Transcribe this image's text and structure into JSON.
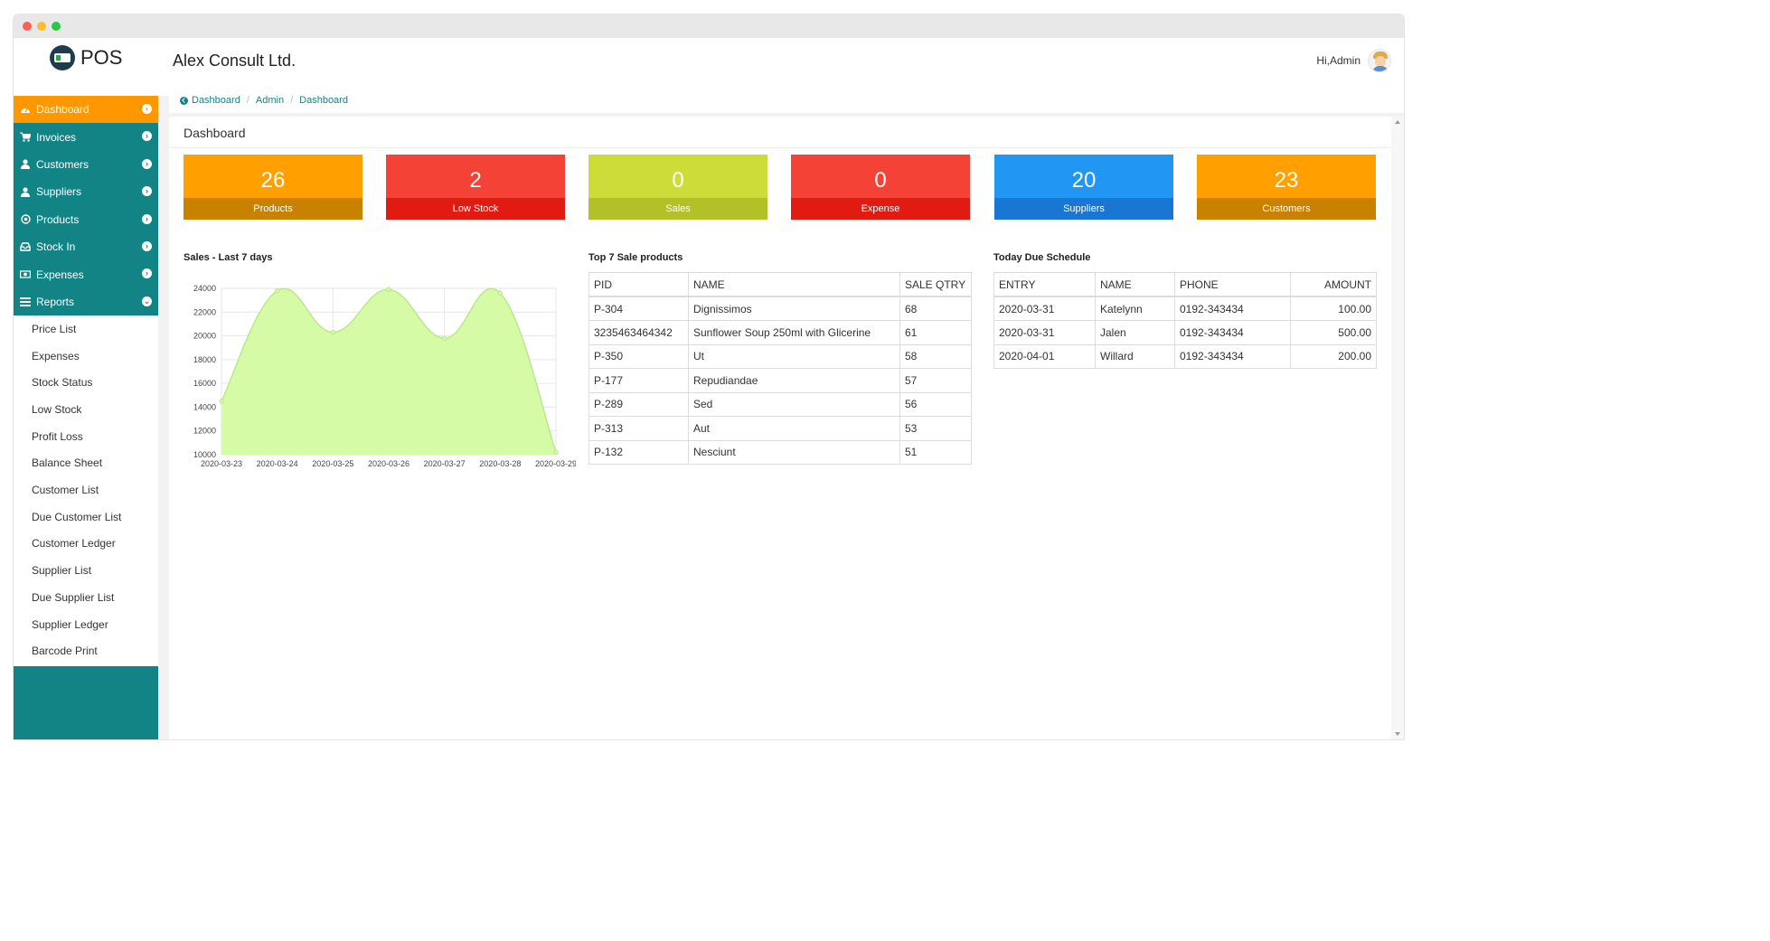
{
  "window": {
    "controls": [
      "close",
      "minimize",
      "maximize"
    ],
    "control_colors": [
      "#ff5f57",
      "#febc2e",
      "#28c840"
    ]
  },
  "brand": {
    "name": "POS",
    "logo_text": "POS"
  },
  "header": {
    "company": "Alex Consult Ltd.",
    "greeting": "Hi,Admin"
  },
  "colors": {
    "teal": "#138486",
    "orange": "#ff9800",
    "red": "#f44336",
    "lime": "#cddc39",
    "blue": "#2196f3",
    "link": "#138486"
  },
  "sidebar": {
    "items": [
      {
        "label": "Dashboard",
        "icon": "dashboard-icon",
        "active": true
      },
      {
        "label": "Invoices",
        "icon": "cart-icon"
      },
      {
        "label": "Customers",
        "icon": "users-icon"
      },
      {
        "label": "Suppliers",
        "icon": "users-icon"
      },
      {
        "label": "Products",
        "icon": "target-icon"
      },
      {
        "label": "Stock In",
        "icon": "inbox-icon"
      },
      {
        "label": "Expenses",
        "icon": "money-icon"
      },
      {
        "label": "Reports",
        "icon": "list-icon",
        "expanded": true
      }
    ],
    "report_items": [
      "Price List",
      "Expenses",
      "Stock Status",
      "Low Stock",
      "Profit Loss",
      "Balance Sheet",
      "Customer List",
      "Due Customer List",
      "Customer Ledger",
      "Supplier List",
      "Due Supplier List",
      "Supplier Ledger",
      "Barcode Print"
    ]
  },
  "breadcrumb": [
    "Dashboard",
    "Admin",
    "Dashboard"
  ],
  "page_title": "Dashboard",
  "stats": [
    {
      "value": "26",
      "label": "Products",
      "top": "#ffa000",
      "bottom": "#c98200"
    },
    {
      "value": "2",
      "label": "Low Stock",
      "top": "#f44336",
      "bottom": "#e11a12"
    },
    {
      "value": "0",
      "label": "Sales",
      "top": "#cddc39",
      "bottom": "#b3c027"
    },
    {
      "value": "0",
      "label": "Expense",
      "top": "#f44336",
      "bottom": "#e11a12"
    },
    {
      "value": "20",
      "label": "Suppliers",
      "top": "#2196f3",
      "bottom": "#1976d2"
    },
    {
      "value": "23",
      "label": "Customers",
      "top": "#ffa000",
      "bottom": "#c98200"
    }
  ],
  "sales_chart_title": "Sales - Last 7 days",
  "chart_data": {
    "type": "area",
    "x": [
      "2020-03-23",
      "2020-03-24",
      "2020-03-25",
      "2020-03-26",
      "2020-03-27",
      "2020-03-28",
      "2020-03-29"
    ],
    "values": [
      14500,
      23800,
      20300,
      23900,
      19800,
      23600,
      10200
    ],
    "ylim": [
      10000,
      24000
    ],
    "yticks": [
      10000,
      12000,
      14000,
      16000,
      18000,
      20000,
      22000,
      24000
    ],
    "grid": true,
    "fill": "#d6fba6",
    "stroke": "#b9e88a"
  },
  "top_products": {
    "title": "Top 7 Sale products",
    "columns": [
      "PID",
      "NAME",
      "SALE QTRY"
    ],
    "rows": [
      [
        "P-304",
        "Dignissimos",
        "68"
      ],
      [
        "3235463464342",
        "Sunflower Soup 250ml with Glicerine",
        "61"
      ],
      [
        "P-350",
        "Ut",
        "58"
      ],
      [
        "P-177",
        "Repudiandae",
        "57"
      ],
      [
        "P-289",
        "Sed",
        "56"
      ],
      [
        "P-313",
        "Aut",
        "53"
      ],
      [
        "P-132",
        "Nesciunt",
        "51"
      ]
    ]
  },
  "due_schedule": {
    "title": "Today Due Schedule",
    "columns": [
      "ENTRY",
      "NAME",
      "PHONE",
      "AMOUNT"
    ],
    "rows": [
      [
        "2020-03-31",
        "Katelynn",
        "0192-343434",
        "100.00"
      ],
      [
        "2020-03-31",
        "Jalen",
        "0192-343434",
        "500.00"
      ],
      [
        "2020-04-01",
        "Willard",
        "0192-343434",
        "200.00"
      ]
    ]
  }
}
